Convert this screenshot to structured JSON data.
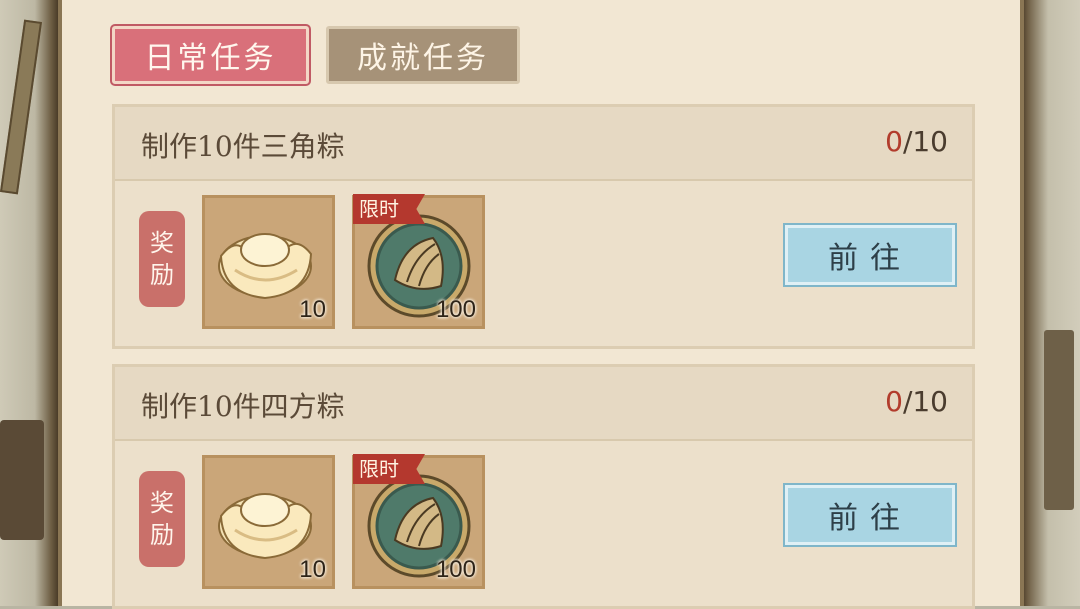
{
  "tabs": [
    {
      "label": "日常任务",
      "active": true
    },
    {
      "label": "成就任务",
      "active": false
    }
  ],
  "reward_label": [
    "奖",
    "励"
  ],
  "tasks": [
    {
      "title": "制作10件三角粽",
      "progress_current": "0",
      "progress_total": "/10",
      "rewards": [
        {
          "icon": "gold-ingot-icon",
          "qty": "10",
          "limited": false
        },
        {
          "icon": "zongzi-coin-icon",
          "qty": "100",
          "limited": true,
          "tag": "限时"
        }
      ],
      "button": "前往"
    },
    {
      "title": "制作10件四方粽",
      "progress_current": "0",
      "progress_total": "/10",
      "rewards": [
        {
          "icon": "gold-ingot-icon",
          "qty": "10",
          "limited": false
        },
        {
          "icon": "zongzi-coin-icon",
          "qty": "100",
          "limited": true,
          "tag": "限时"
        }
      ],
      "button": "前往"
    }
  ],
  "colors": {
    "panel": "#f2e7d3",
    "active_tab": "#d9707a",
    "inactive_tab": "#a69278",
    "progress_red": "#b23c2c",
    "go_button": "#a9d5e3"
  }
}
